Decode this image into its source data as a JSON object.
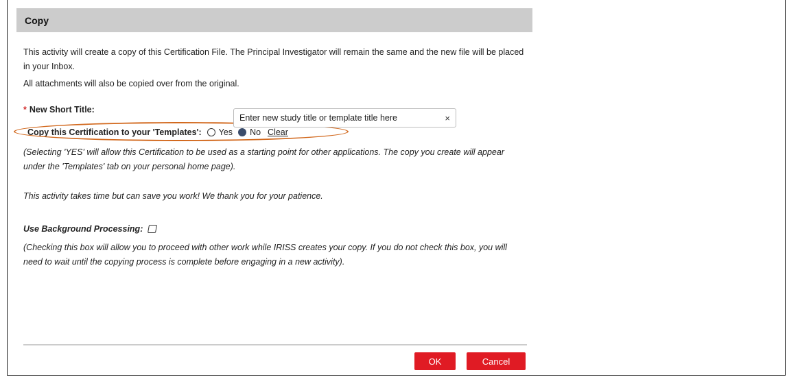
{
  "dialog": {
    "title": "Copy",
    "intro_line": "This activity will create a copy of this Certification File. The Principal Investigator will remain the same and the new file will be placed in your Inbox.",
    "attachments_line": "All attachments will also be copied over from the original.",
    "short_title": {
      "required_mark": "*",
      "label": "New Short Title:",
      "value": "Enter new study title or template title here",
      "clear_symbol": "×"
    },
    "copy_templates": {
      "label": "Copy this Certification to your 'Templates':",
      "options": [
        "Yes",
        "No"
      ],
      "selected": "No",
      "clear_label": "Clear",
      "highlight_color": "#d2691e"
    },
    "templates_note": "(Selecting 'YES' will allow this Certification to be used as a starting point for other applications. The copy you create will appear under the 'Templates' tab on your personal home page).",
    "patience_note": "This activity takes time but can save you work! We thank you for your patience.",
    "background_processing": {
      "label": "Use Background Processing:",
      "checked": false
    },
    "background_note": "(Checking this box will allow you to proceed with other work while IRISS creates your copy. If you do not check this box, you will need to wait until the copying process is complete before engaging in a new activity).",
    "buttons": {
      "ok_label": "OK",
      "cancel_label": "Cancel",
      "color": "#e01b24"
    }
  }
}
